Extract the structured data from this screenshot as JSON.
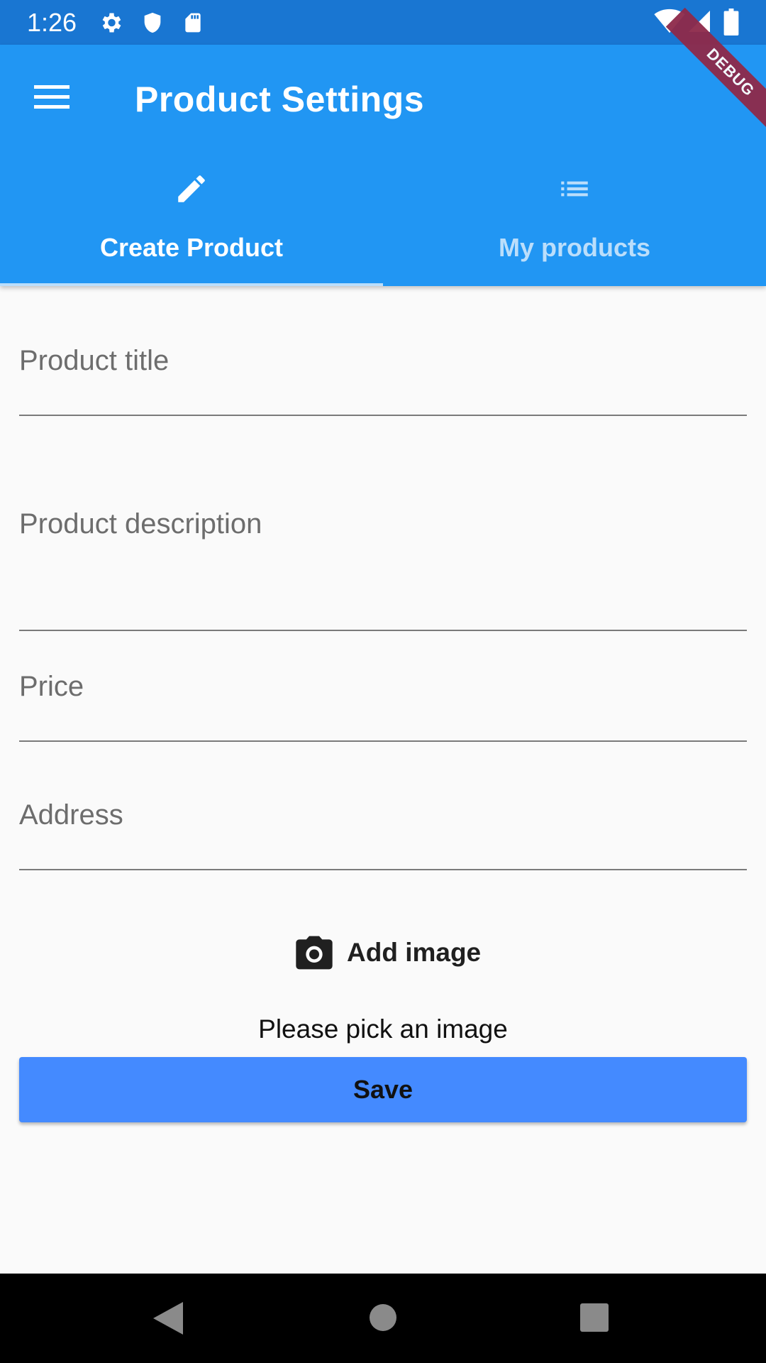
{
  "status_bar": {
    "time": "1:26",
    "left_icons": [
      "settings-icon",
      "shield-icon",
      "sd-card-icon"
    ],
    "right_icons": [
      "wifi-icon",
      "signal-icon",
      "battery-icon"
    ],
    "color": "#1976d2"
  },
  "app_bar": {
    "title": "Product Settings",
    "menu_icon": "menu-icon",
    "color": "#2196f3"
  },
  "tabs": [
    {
      "label": "Create Product",
      "icon": "pencil-icon",
      "selected": true
    },
    {
      "label": "My products",
      "icon": "list-icon",
      "selected": false
    }
  ],
  "form": {
    "title_field": {
      "label": "Product title",
      "value": ""
    },
    "description_field": {
      "label": "Product description",
      "value": ""
    },
    "price_field": {
      "label": "Price",
      "value": ""
    },
    "address_field": {
      "label": "Address",
      "value": ""
    }
  },
  "add_image": {
    "label": "Add image",
    "icon": "camera-icon"
  },
  "image_hint": "Please pick an image",
  "save_button": {
    "label": "Save",
    "color": "#448aff"
  },
  "debug_banner": "DEBUG",
  "nav_bar": {
    "icons": [
      "back-icon",
      "home-icon",
      "recents-icon"
    ]
  }
}
